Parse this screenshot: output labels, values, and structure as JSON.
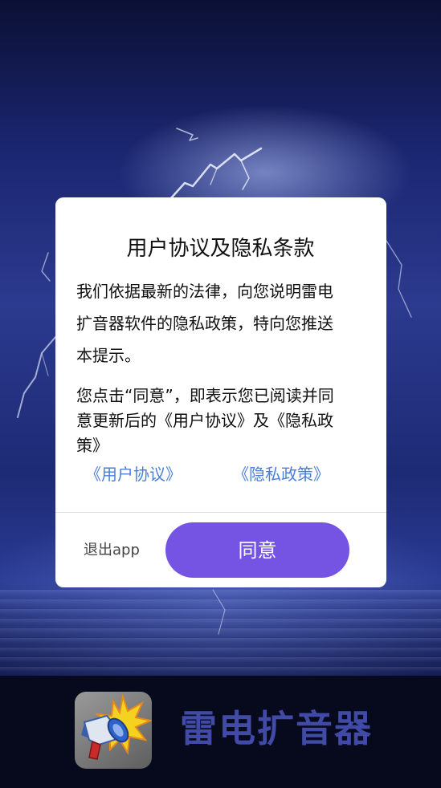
{
  "dialog": {
    "title": "用户协议及隐私条款",
    "paragraph1_lines": [
      "我们依据最新的法律，向您说明雷电",
      "扩音器软件的隐私政策，特向您推送",
      "本提示。"
    ],
    "paragraph2_lines": [
      "您点击“同意”，即表示您已阅读并同",
      "意更新后的《用户协议》及《隐私政",
      "策》"
    ],
    "link_agreement": "《用户协议》",
    "link_privacy": "《隐私政策》",
    "exit_label": "退出app",
    "agree_label": "同意"
  },
  "footer": {
    "app_name": "雷电扩音器",
    "app_icon": "megaphone-icon"
  },
  "colors": {
    "agree_button": "#7554e4",
    "link": "#4a7fd8",
    "brand_text": "#414aa6"
  }
}
